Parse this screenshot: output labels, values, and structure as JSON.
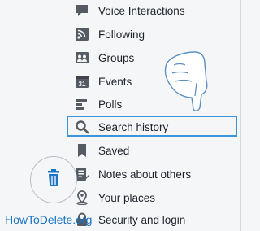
{
  "menu": {
    "items": [
      {
        "label": "Voice Interactions",
        "icon": "chat-bubble-icon"
      },
      {
        "label": "Following",
        "icon": "rss-feed-icon"
      },
      {
        "label": "Groups",
        "icon": "groups-icon"
      },
      {
        "label": "Events",
        "icon": "calendar-icon"
      },
      {
        "label": "Polls",
        "icon": "polls-bars-icon"
      },
      {
        "label": "Search history",
        "icon": "search-icon"
      },
      {
        "label": "Saved",
        "icon": "bookmark-icon"
      },
      {
        "label": "Notes about others",
        "icon": "notes-icon"
      },
      {
        "label": "Your places",
        "icon": "map-pin-icon"
      },
      {
        "label": "Security and login",
        "icon": "lock-icon"
      }
    ],
    "highlighted": "Search history",
    "calendar_icon_text": "31"
  },
  "watermark": {
    "text": "HowToDelete.org"
  },
  "colors": {
    "highlight": "#3c94d8",
    "icon": "#555b63",
    "trash": "#1b74c4",
    "watermark": "#1b74c4"
  }
}
